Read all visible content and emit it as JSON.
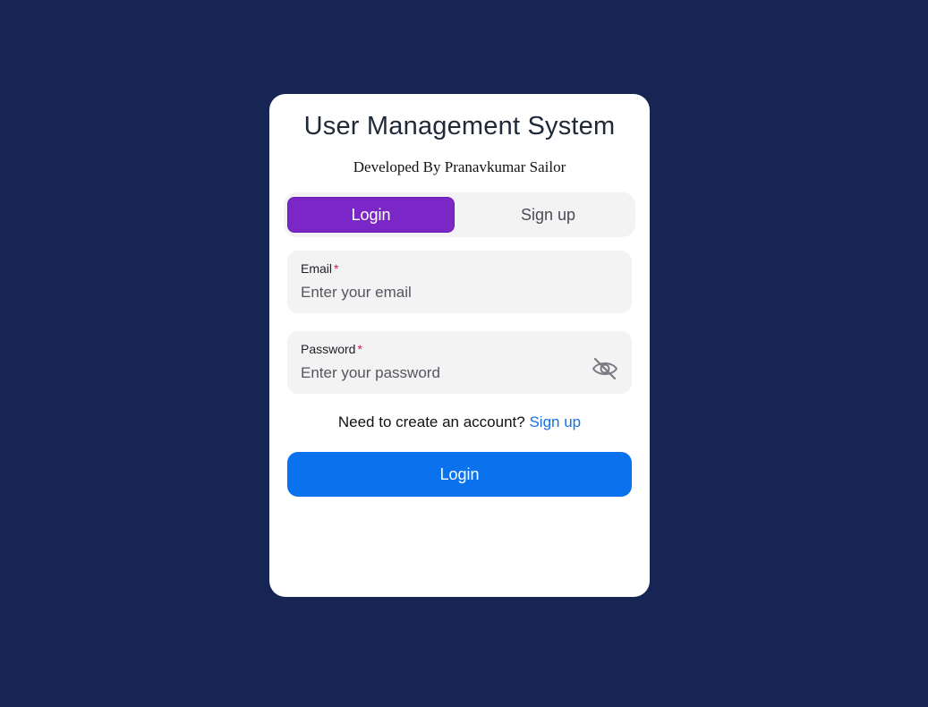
{
  "page": {
    "background_color": "#172554"
  },
  "card": {
    "title": "User Management System",
    "subtitle": "Developed By Pranavkumar Sailor"
  },
  "tabs": [
    {
      "label": "Login",
      "active": true
    },
    {
      "label": "Sign up",
      "active": false
    }
  ],
  "form": {
    "email": {
      "label": "Email",
      "required_marker": "*",
      "placeholder": "Enter your email",
      "value": ""
    },
    "password": {
      "label": "Password",
      "required_marker": "*",
      "placeholder": "Enter your password",
      "value": "",
      "toggle_icon": "eye-slash-icon"
    },
    "switch_prompt": "Need to create an account?",
    "switch_link": "Sign up",
    "submit_label": "Login"
  },
  "colors": {
    "active_tab": "#7b27c8",
    "primary_button": "#0b72ee",
    "link": "#1670e6",
    "required": "#d11a5a"
  }
}
